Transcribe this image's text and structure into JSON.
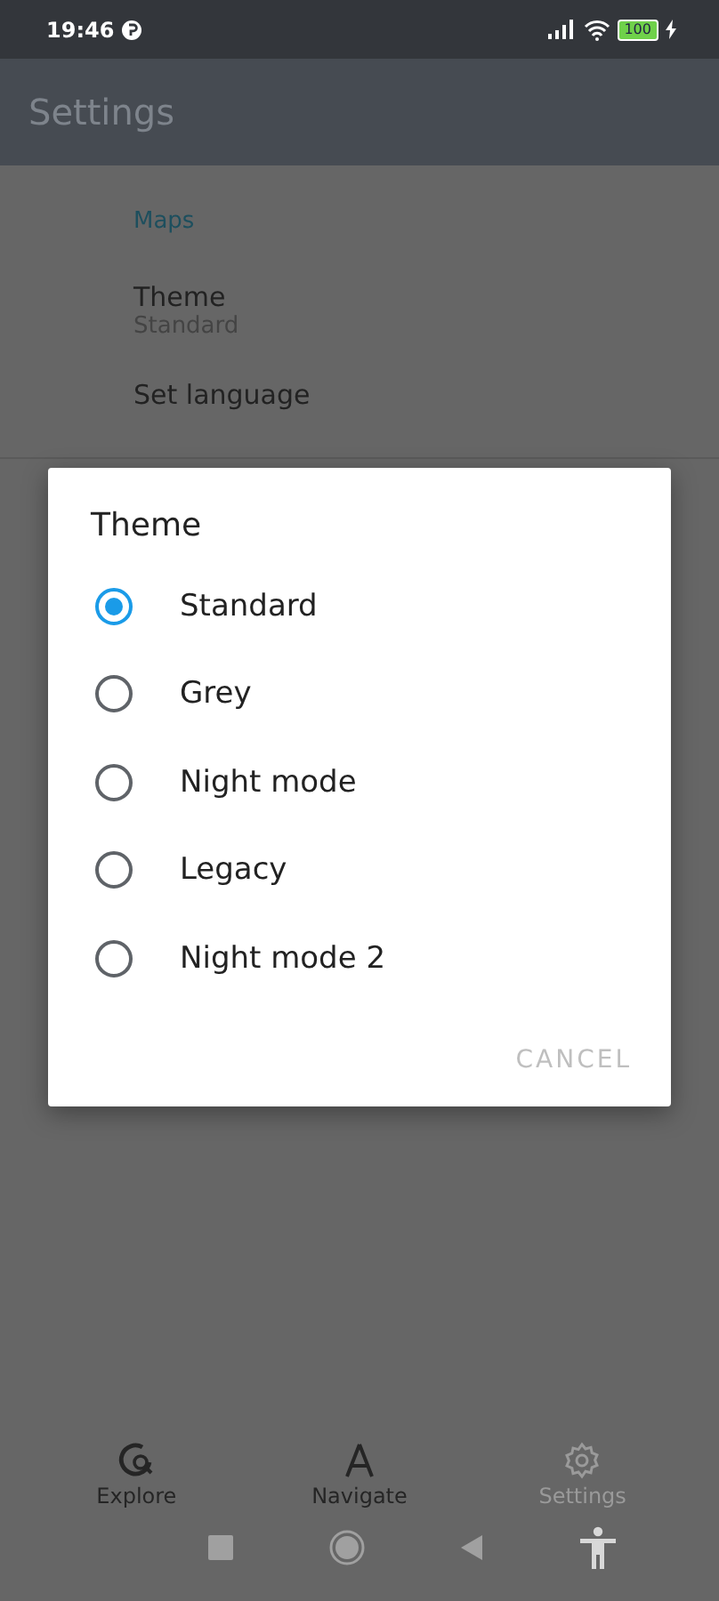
{
  "status_bar": {
    "time": "19:46",
    "battery": "100"
  },
  "app_bar": {
    "title": "Settings"
  },
  "sections": [
    {
      "header": "Maps",
      "items": [
        {
          "title": "Theme",
          "summary": "Standard"
        },
        {
          "title": "Set language"
        }
      ]
    }
  ],
  "dialog": {
    "title": "Theme",
    "options": [
      {
        "label": "Standard",
        "selected": true
      },
      {
        "label": "Grey",
        "selected": false
      },
      {
        "label": "Night mode",
        "selected": false
      },
      {
        "label": "Legacy",
        "selected": false
      },
      {
        "label": "Night mode 2",
        "selected": false
      }
    ],
    "buttons": [
      "CANCEL"
    ]
  },
  "bottom_nav": [
    {
      "kind": "explore",
      "label": "Explore",
      "selected": false
    },
    {
      "kind": "navigate",
      "label": "Navigate",
      "selected": false
    },
    {
      "kind": "settings",
      "label": "Settings",
      "selected": true
    }
  ]
}
